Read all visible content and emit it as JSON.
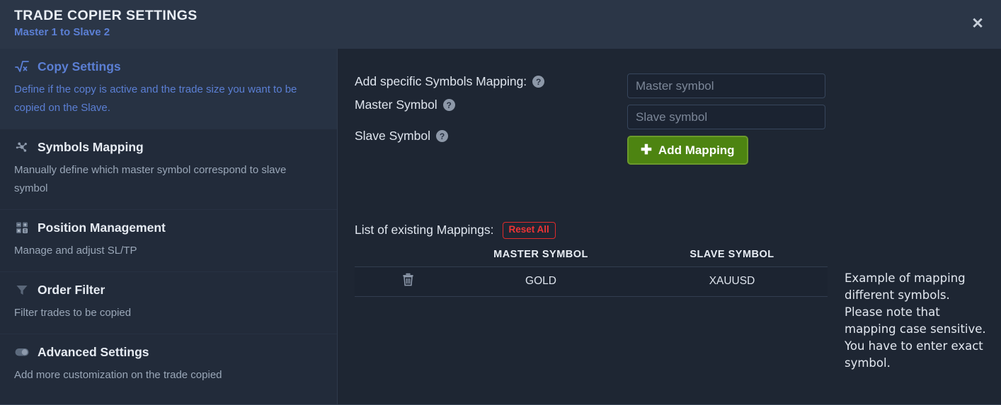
{
  "header": {
    "title": "TRADE COPIER SETTINGS",
    "subtitle": "Master 1 to Slave 2",
    "close_icon": "✕"
  },
  "sidebar": {
    "items": [
      {
        "label": "Copy Settings",
        "desc": "Define if the copy is active and the trade size you want to be copied on the Slave.",
        "icon": "sqrt-x-icon",
        "active": true
      },
      {
        "label": "Symbols Mapping",
        "desc": "Manually define which master symbol correspond to slave symbol",
        "icon": "network-nodes-icon",
        "active": false
      },
      {
        "label": "Position Management",
        "desc": "Manage and adjust SL/TP",
        "icon": "calculator-grid-icon",
        "active": false
      },
      {
        "label": "Order Filter",
        "desc": "Filter trades to be copied",
        "icon": "funnel-icon",
        "active": false
      },
      {
        "label": "Advanced Settings",
        "desc": "Add more customization on the trade copied",
        "icon": "toggle-switch-icon",
        "active": false
      }
    ]
  },
  "main": {
    "section_label": "Add specific Symbols Mapping:",
    "master_label": "Master Symbol",
    "slave_label": "Slave Symbol",
    "help_glyph": "?",
    "master_input": {
      "value": "",
      "placeholder": "Master symbol"
    },
    "slave_input": {
      "value": "",
      "placeholder": "Slave symbol"
    },
    "add_button": {
      "label": "Add Mapping",
      "icon": "plus-icon",
      "glyph": "✚"
    },
    "list_title": "List of existing Mappings:",
    "reset_button": "Reset All",
    "table": {
      "columns": [
        "",
        "MASTER SYMBOL",
        "SLAVE SYMBOL"
      ],
      "rows": [
        {
          "delete_icon": "trash-icon",
          "master": "GOLD",
          "slave": "XAUUSD"
        }
      ]
    },
    "note": "Example of mapping different symbols. Please note that mapping case sensitive. You have to enter exact symbol."
  },
  "colors": {
    "header_bg": "#2b3647",
    "sidebar_bg": "#222b3a",
    "sidebar_active_bg": "#273243",
    "main_bg": "#1e2633",
    "accent_blue": "#5b7fd4",
    "add_green": "#4d8411",
    "reset_red": "#ee3434"
  }
}
